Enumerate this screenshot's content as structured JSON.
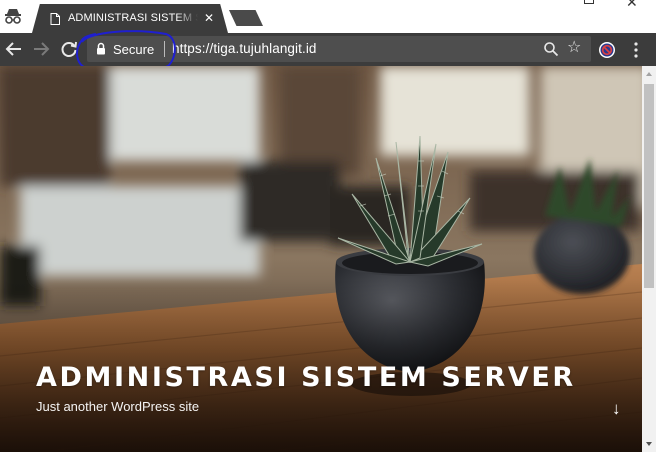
{
  "browser": {
    "tab": {
      "title": "ADMINISTRASI SISTEM SERVER",
      "close_label": "✕"
    },
    "toolbar": {
      "back_icon": "back-arrow-icon",
      "forward_icon": "forward-arrow-icon",
      "reload_icon": "reload-icon",
      "security_label": "Secure",
      "url": "https://tiga.tujuhlangit.id",
      "bookmark_icon": "star-icon",
      "zoom_icon": "magnifier-icon",
      "extension_icon": "blocked-circle-icon",
      "menu_icon": "three-dot-menu-icon"
    },
    "colors": {
      "toolbar": "#3c3c3c",
      "omnibox": "#4e4e4e",
      "annotation": "#1f1fd0"
    }
  },
  "page": {
    "site_title": "ADMINISTRASI SISTEM SERVER",
    "tagline": "Just another WordPress site",
    "scroll_down_glyph": "↓"
  }
}
